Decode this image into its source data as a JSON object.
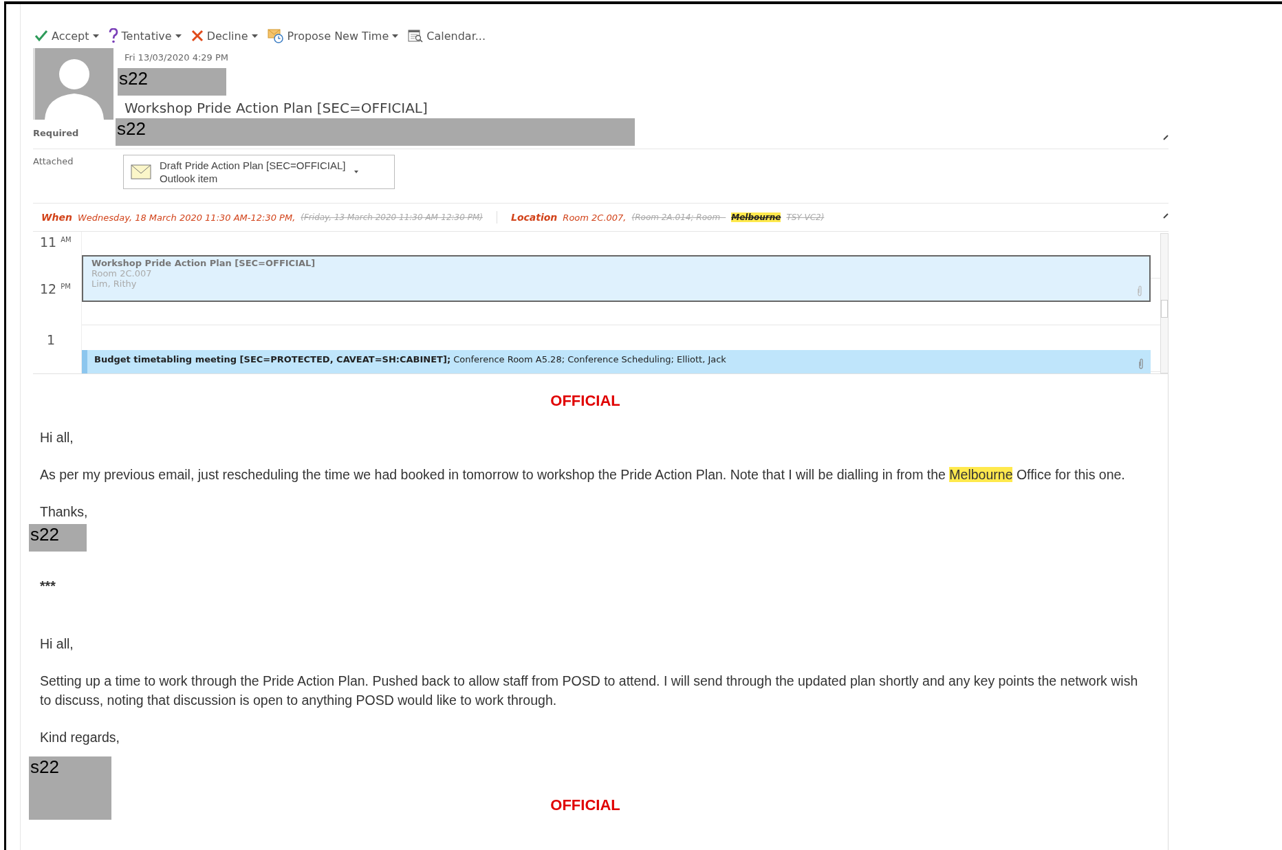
{
  "toolbar": [
    {
      "kind": "accept",
      "label": "Accept",
      "has_menu": true
    },
    {
      "kind": "tentative",
      "label": "Tentative",
      "has_menu": true
    },
    {
      "kind": "decline",
      "label": "Decline",
      "has_menu": true
    },
    {
      "kind": "propose",
      "label": "Propose New Time",
      "has_menu": true
    },
    {
      "kind": "calendar",
      "label": "Calendar...",
      "has_menu": false
    }
  ],
  "header": {
    "sent": "Fri 13/03/2020 4:29 PM",
    "sender_redaction": "s22",
    "subject": "Workshop Pride Action Plan [SEC=OFFICIAL]"
  },
  "required": {
    "label": "Required",
    "redaction": "s22"
  },
  "attached": {
    "label": "Attached",
    "item": {
      "title": "Draft Pride Action Plan [SEC=OFFICIAL]",
      "type": "Outlook item"
    }
  },
  "when": {
    "label": "When",
    "value": "Wednesday, 18 March 2020 11:30 AM-12:30 PM,",
    "previous": "(Friday, 13 March 2020 11:30 AM-12:30 PM)"
  },
  "location": {
    "label": "Location",
    "value": "Room 2C.007,",
    "previous_parts": [
      {
        "text": "(Room 2A.014; Room -",
        "highlighted": false
      },
      {
        "text": "Melbourne",
        "highlighted": true
      },
      {
        "text": "TSY VC2)",
        "highlighted": false
      }
    ]
  },
  "calendar": {
    "hours": [
      {
        "hour": "11",
        "suffix": "AM"
      },
      {
        "hour": "12",
        "suffix": "PM"
      },
      {
        "hour": "1"
      }
    ],
    "events": [
      {
        "kind": "current",
        "title": "Workshop Pride Action Plan [SEC=OFFICIAL]",
        "lines": [
          "Room 2C.007",
          "Lim, Rithy"
        ],
        "attachment": true
      },
      {
        "kind": "other",
        "text": "**Budget timetabling meeting [SEC=PROTECTED, CAVEAT=SH:CABINET];** Conference Room A5.28; Conference Scheduling; Elliott, Jack",
        "attachment": true
      }
    ]
  },
  "body": [
    {
      "kind": "classification",
      "text": "OFFICIAL"
    },
    {
      "kind": "paragraph",
      "parts": [
        {
          "text": "Hi all,",
          "highlighted": false
        }
      ]
    },
    {
      "kind": "paragraph",
      "parts": [
        {
          "text": "As per my previous email, just rescheduling the time we had booked in tomorrow to workshop the Pride Action Plan. Note that I will be dialling in from the",
          "highlighted": false
        },
        {
          "text": "Melbourne",
          "highlighted": true
        },
        {
          "text": "Office for this one.",
          "highlighted": false
        }
      ]
    },
    {
      "kind": "paragraph",
      "parts": [
        {
          "text": "Thanks,",
          "highlighted": false
        }
      ]
    },
    {
      "kind": "redaction",
      "text": "s22"
    },
    {
      "kind": "separator",
      "text": "***"
    },
    {
      "kind": "paragraph",
      "parts": [
        {
          "text": "Hi all,",
          "highlighted": false
        }
      ]
    },
    {
      "kind": "paragraph",
      "parts": [
        {
          "text": "Setting up a time to work through the Pride Action Plan. Pushed back to allow staff from POSD to attend. I will send through the updated plan shortly and any key points the network wish to discuss, noting that discussion is open to anything POSD would like to work through.",
          "highlighted": false
        }
      ]
    },
    {
      "kind": "paragraph",
      "parts": [
        {
          "text": "Kind regards,",
          "highlighted": false
        }
      ]
    },
    {
      "kind": "redactionblock",
      "text": "s22"
    },
    {
      "kind": "classification",
      "text": "OFFICIAL"
    }
  ]
}
